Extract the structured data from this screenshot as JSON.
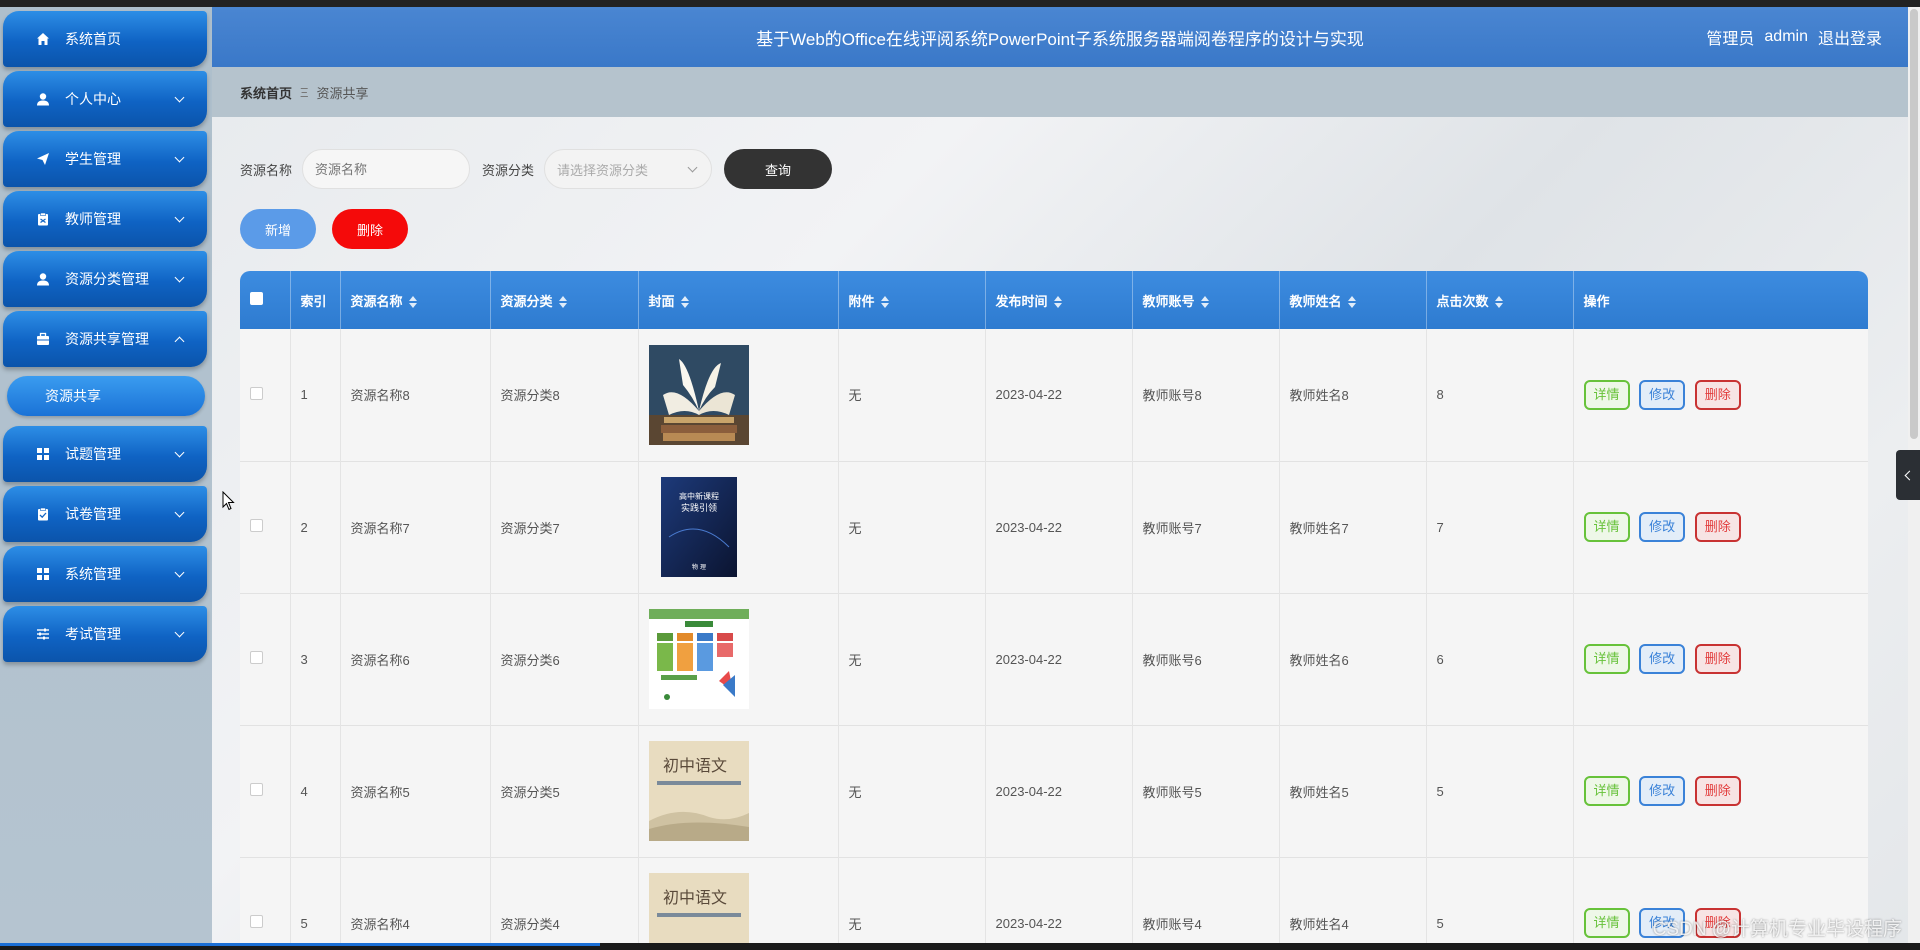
{
  "header": {
    "title": "基于Web的Office在线评阅系统PowerPoint子系统服务器端阅卷程序的设计与实现",
    "role": "管理员",
    "username": "admin",
    "logout": "退出登录"
  },
  "breadcrumb": {
    "home": "系统首页",
    "separator": "Ξ",
    "current": "资源共享"
  },
  "sidebar": {
    "items": [
      {
        "label": "系统首页",
        "icon": "home-icon"
      },
      {
        "label": "个人中心",
        "icon": "user-icon"
      },
      {
        "label": "学生管理",
        "icon": "send-icon"
      },
      {
        "label": "教师管理",
        "icon": "clipboard-icon"
      },
      {
        "label": "资源分类管理",
        "icon": "user-icon"
      },
      {
        "label": "资源共享管理",
        "icon": "briefcase-icon"
      },
      {
        "label": "试题管理",
        "icon": "grid-icon"
      },
      {
        "label": "试卷管理",
        "icon": "clipboard-check-icon"
      },
      {
        "label": "系统管理",
        "icon": "grid-icon"
      },
      {
        "label": "考试管理",
        "icon": "sliders-icon"
      }
    ],
    "submenu_active": "资源共享"
  },
  "search": {
    "name_label": "资源名称",
    "name_placeholder": "资源名称",
    "category_label": "资源分类",
    "category_placeholder": "请选择资源分类",
    "query_button": "查询"
  },
  "actions": {
    "add": "新增",
    "delete": "删除"
  },
  "table": {
    "columns": [
      "索引",
      "资源名称",
      "资源分类",
      "封面",
      "附件",
      "发布时间",
      "教师账号",
      "教师姓名",
      "点击次数",
      "操作"
    ],
    "rows": [
      {
        "index": "1",
        "name": "资源名称8",
        "category": "资源分类8",
        "attachment": "无",
        "date": "2023-04-22",
        "account": "教师账号8",
        "teacher": "教师姓名8",
        "clicks": "8"
      },
      {
        "index": "2",
        "name": "资源名称7",
        "category": "资源分类7",
        "attachment": "无",
        "date": "2023-04-22",
        "account": "教师账号7",
        "teacher": "教师姓名7",
        "clicks": "7"
      },
      {
        "index": "3",
        "name": "资源名称6",
        "category": "资源分类6",
        "attachment": "无",
        "date": "2023-04-22",
        "account": "教师账号6",
        "teacher": "教师姓名6",
        "clicks": "6"
      },
      {
        "index": "4",
        "name": "资源名称5",
        "category": "资源分类5",
        "attachment": "无",
        "date": "2023-04-22",
        "account": "教师账号5",
        "teacher": "教师姓名5",
        "clicks": "5"
      },
      {
        "index": "5",
        "name": "资源名称4",
        "category": "资源分类4",
        "attachment": "无",
        "date": "2023-04-22",
        "account": "教师账号4",
        "teacher": "教师姓名4",
        "clicks": "5"
      }
    ],
    "op_detail": "详情",
    "op_edit": "修改",
    "op_delete": "删除"
  },
  "covers": {
    "book2_title": "高中新课程",
    "book2_subtitle": "实践引领",
    "book2_footer": "物 理",
    "book4_title": "初中语文"
  },
  "watermark": "CSDN @计算机专业毕设程序",
  "colors": {
    "header_bg": "#3a78c8",
    "menu_bg": "#0f63c4",
    "table_head": "#2e7bd0",
    "add_button": "#5b9be8",
    "delete_button": "#f50a0a",
    "query_button": "#333333"
  }
}
